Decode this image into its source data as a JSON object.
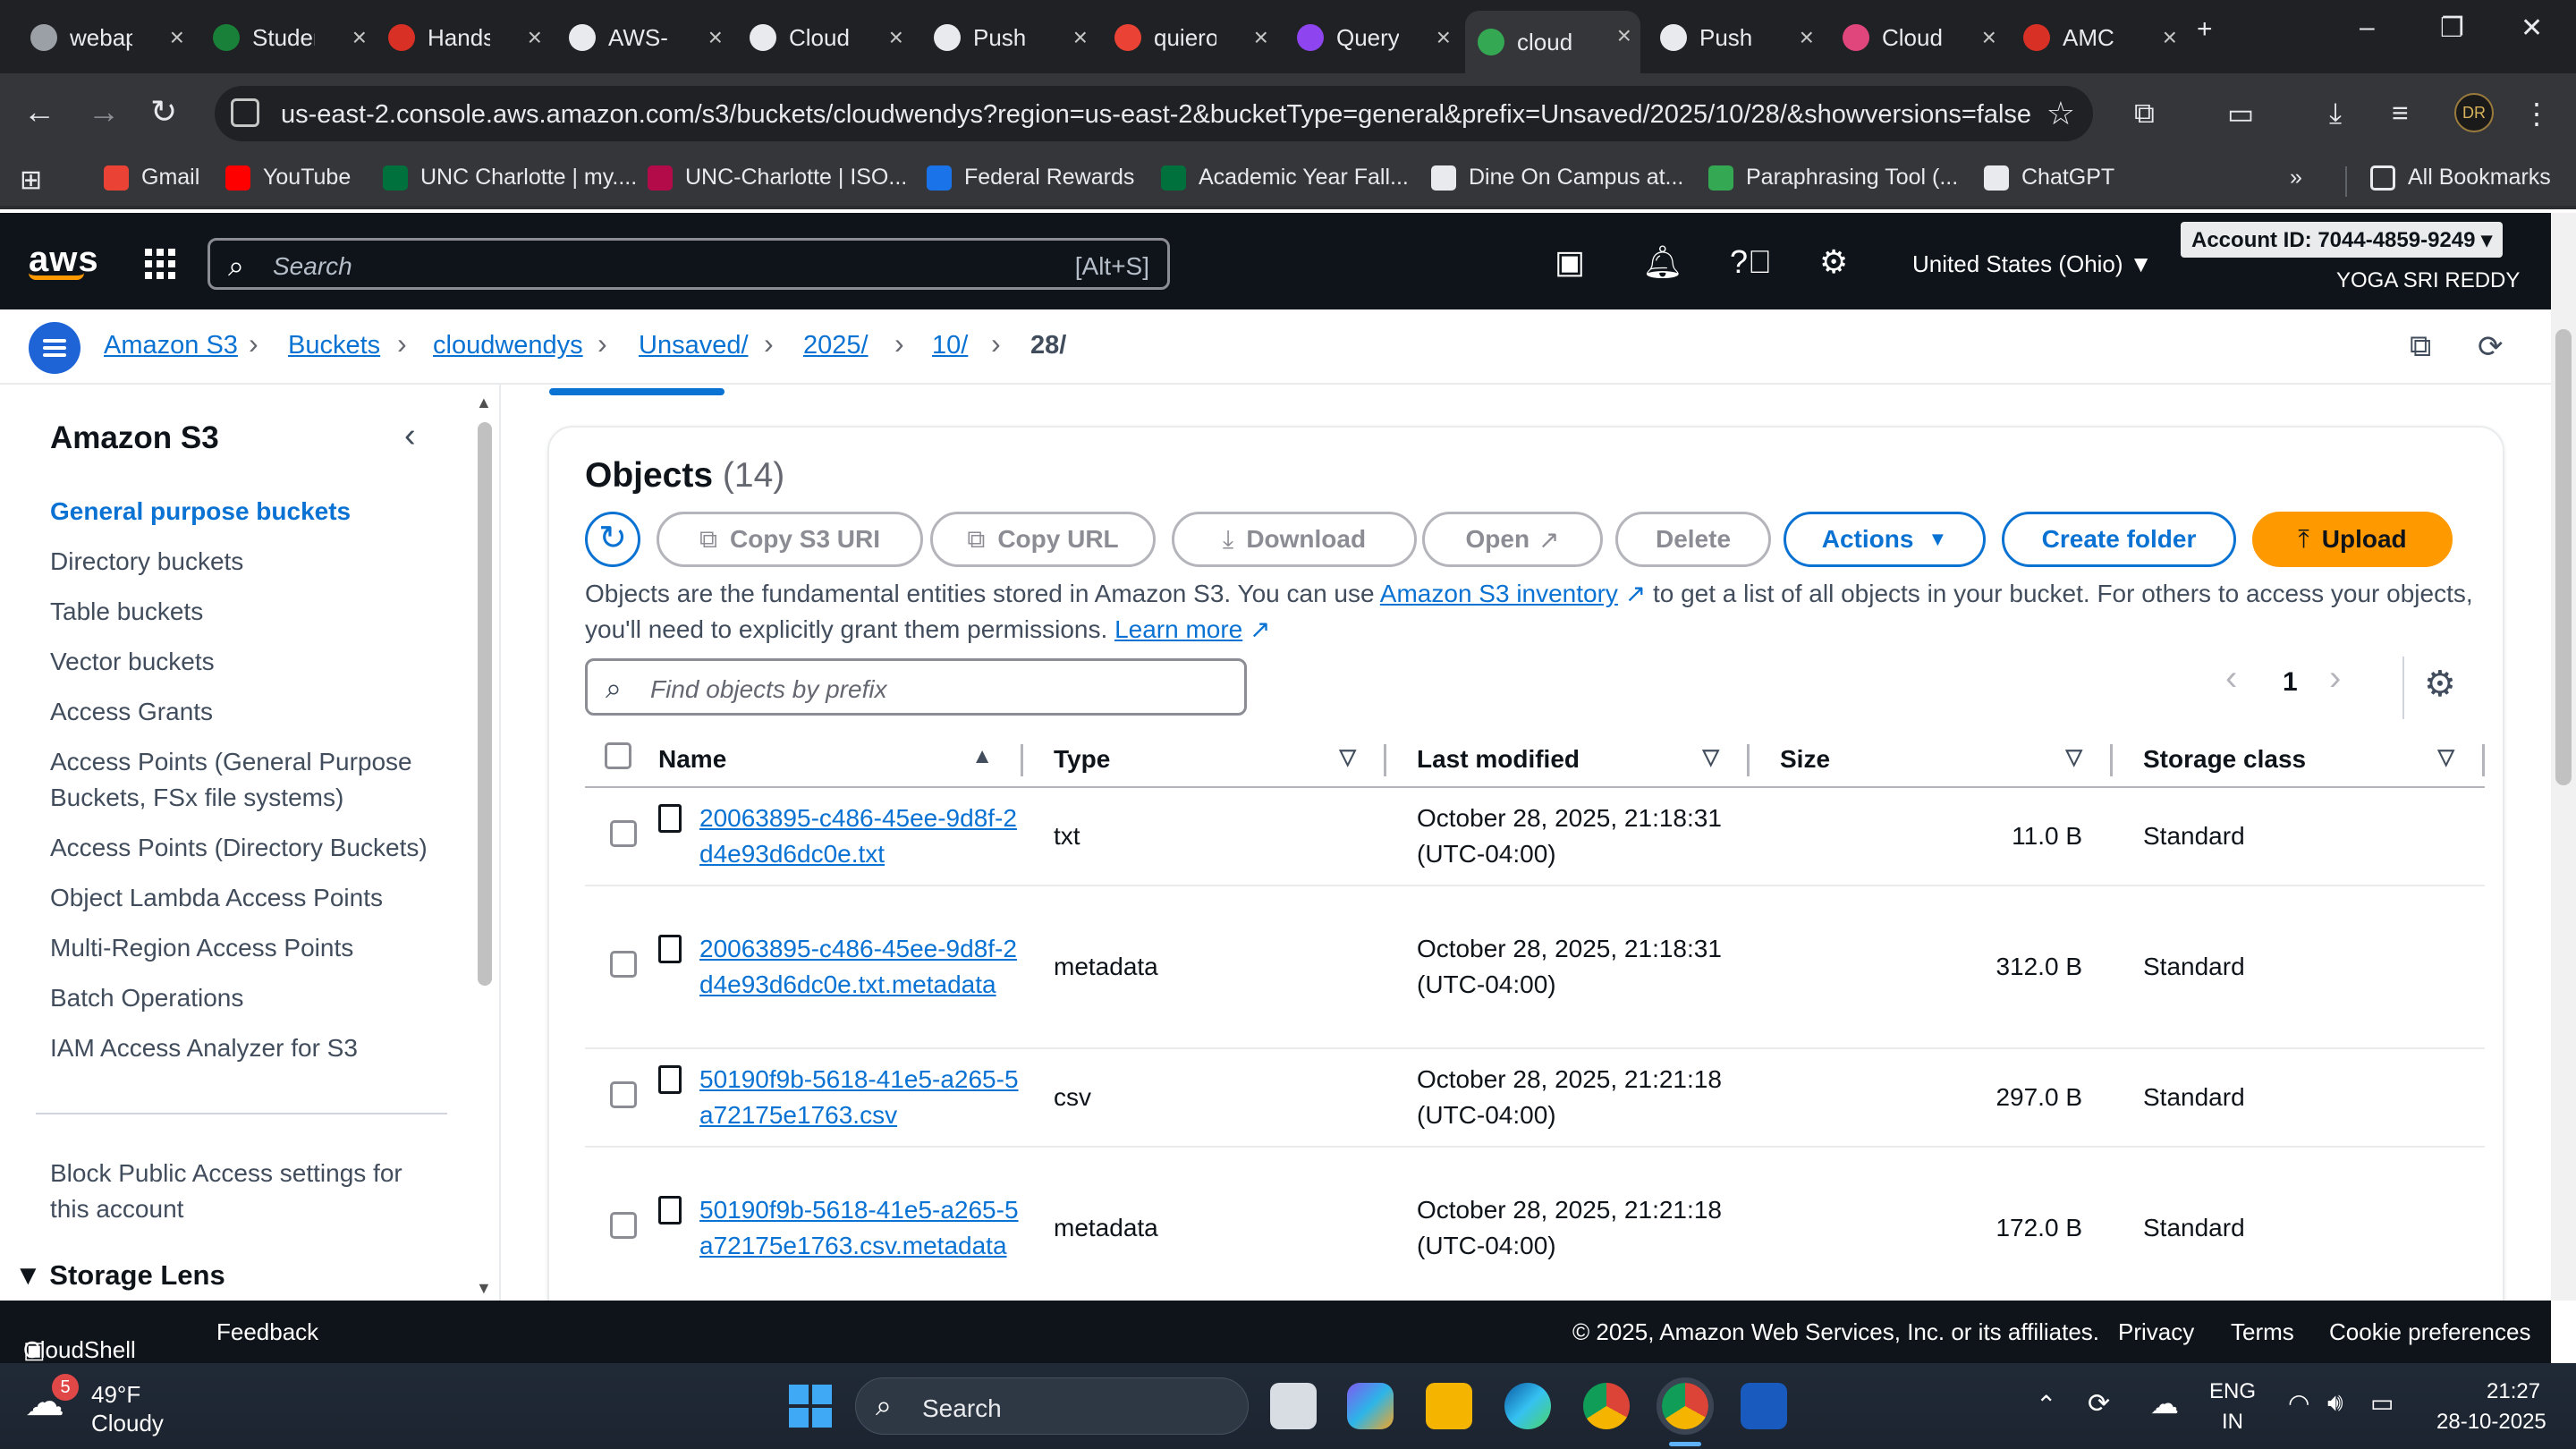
{
  "browser": {
    "tabs": [
      {
        "title": "webapp",
        "color": "#9aa0a6"
      },
      {
        "title": "Student",
        "color": "#188038"
      },
      {
        "title": "Hands",
        "color": "#d93025"
      },
      {
        "title": "AWS-",
        "color": "#e8eaed"
      },
      {
        "title": "Cloud",
        "color": "#e8eaed"
      },
      {
        "title": "Push",
        "color": "#e8eaed"
      },
      {
        "title": "quiero",
        "color": "#ea4335"
      },
      {
        "title": "Query",
        "color": "#8e44ef"
      },
      {
        "title": "cloud",
        "color": "#34a853"
      },
      {
        "title": "Push",
        "color": "#e8eaed"
      },
      {
        "title": "Cloud",
        "color": "#e0457b"
      },
      {
        "title": "AMC",
        "color": "#d93025"
      }
    ],
    "active_tab_index": 8,
    "url": "us-east-2.console.aws.amazon.com/s3/buckets/cloudwendys?region=us-east-2&bucketType=general&prefix=Unsaved/2025/10/28/&showversions=false",
    "profile_initials": "DR",
    "bookmarks": [
      {
        "label": "Gmail",
        "color": "#ea4335"
      },
      {
        "label": "YouTube",
        "color": "#ff0000"
      },
      {
        "label": "UNC Charlotte | my....",
        "color": "#00703c"
      },
      {
        "label": "UNC-Charlotte | ISO...",
        "color": "#b30b4a"
      },
      {
        "label": "Federal Rewards",
        "color": "#1a73e8"
      },
      {
        "label": "Academic Year Fall...",
        "color": "#00703c"
      },
      {
        "label": "Dine On Campus at...",
        "color": "#e8eaed"
      },
      {
        "label": "Paraphrasing Tool (...",
        "color": "#34a853"
      },
      {
        "label": "ChatGPT",
        "color": "#e8eaed"
      }
    ],
    "more_bookmarks": "»",
    "all_bookmarks": "All Bookmarks"
  },
  "aws": {
    "logo": "aws",
    "search_placeholder": "Search",
    "search_shortcut": "[Alt+S]",
    "region": "United States (Ohio) ▼",
    "account": "Account ID: 7044-4859-9249 ▾",
    "user": "YOGA SRI REDDY"
  },
  "breadcrumb": [
    "Amazon S3",
    "Buckets",
    "cloudwendys",
    "Unsaved/",
    "2025/",
    "10/",
    "28/"
  ],
  "sidebar": {
    "title": "Amazon S3",
    "items": [
      "General purpose buckets",
      "Directory buckets",
      "Table buckets",
      "Vector buckets",
      "Access Grants",
      "Access Points (General Purpose Buckets, FSx file systems)",
      "Access Points (Directory Buckets)",
      "Object Lambda Access Points",
      "Multi-Region Access Points",
      "Batch Operations",
      "IAM Access Analyzer for S3"
    ],
    "block_public": "Block Public Access settings for this account",
    "storage_lens": "Storage Lens"
  },
  "objects": {
    "heading": "Objects",
    "count": "(14)",
    "buttons": {
      "copy_uri": "Copy S3 URI",
      "copy_url": "Copy URL",
      "download": "Download",
      "open": "Open",
      "delete": "Delete",
      "actions": "Actions",
      "create_folder": "Create folder",
      "upload": "Upload"
    },
    "desc_1": "Objects are the fundamental entities stored in Amazon S3. You can use ",
    "desc_link_1": "Amazon S3 inventory",
    "desc_2": " to get a list of all objects in your bucket. For others to access your objects, you'll need to explicitly grant them permissions. ",
    "desc_link_2": "Learn more",
    "filter_placeholder": "Find objects by prefix",
    "page": "1",
    "columns": [
      "Name",
      "Type",
      "Last modified",
      "Size",
      "Storage class"
    ],
    "rows": [
      {
        "name": "20063895-c486-45ee-9d8f-2d4e93d6dc0e.txt",
        "type": "txt",
        "modified": "October 28, 2025, 21:18:31 (UTC-04:00)",
        "size": "11.0 B",
        "storage": "Standard"
      },
      {
        "name": "20063895-c486-45ee-9d8f-2d4e93d6dc0e.txt.metadata",
        "type": "metadata",
        "modified": "October 28, 2025, 21:18:31 (UTC-04:00)",
        "size": "312.0 B",
        "storage": "Standard"
      },
      {
        "name": "50190f9b-5618-41e5-a265-5a72175e1763.csv",
        "type": "csv",
        "modified": "October 28, 2025, 21:21:18 (UTC-04:00)",
        "size": "297.0 B",
        "storage": "Standard"
      },
      {
        "name": "50190f9b-5618-41e5-a265-5a72175e1763.csv.metadata",
        "type": "metadata",
        "modified": "October 28, 2025, 21:21:18 (UTC-04:00)",
        "size": "172.0 B",
        "storage": "Standard"
      }
    ]
  },
  "footer": {
    "cloudshell": "CloudShell",
    "feedback": "Feedback",
    "copyright": "© 2025, Amazon Web Services, Inc. or its affiliates.",
    "privacy": "Privacy",
    "terms": "Terms",
    "cookies": "Cookie preferences"
  },
  "taskbar": {
    "weather_temp": "49°F",
    "weather_desc": "Cloudy",
    "weather_badge": "5",
    "search": "Search",
    "lang_1": "ENG",
    "lang_2": "IN",
    "time": "21:27",
    "date": "28-10-2025"
  }
}
